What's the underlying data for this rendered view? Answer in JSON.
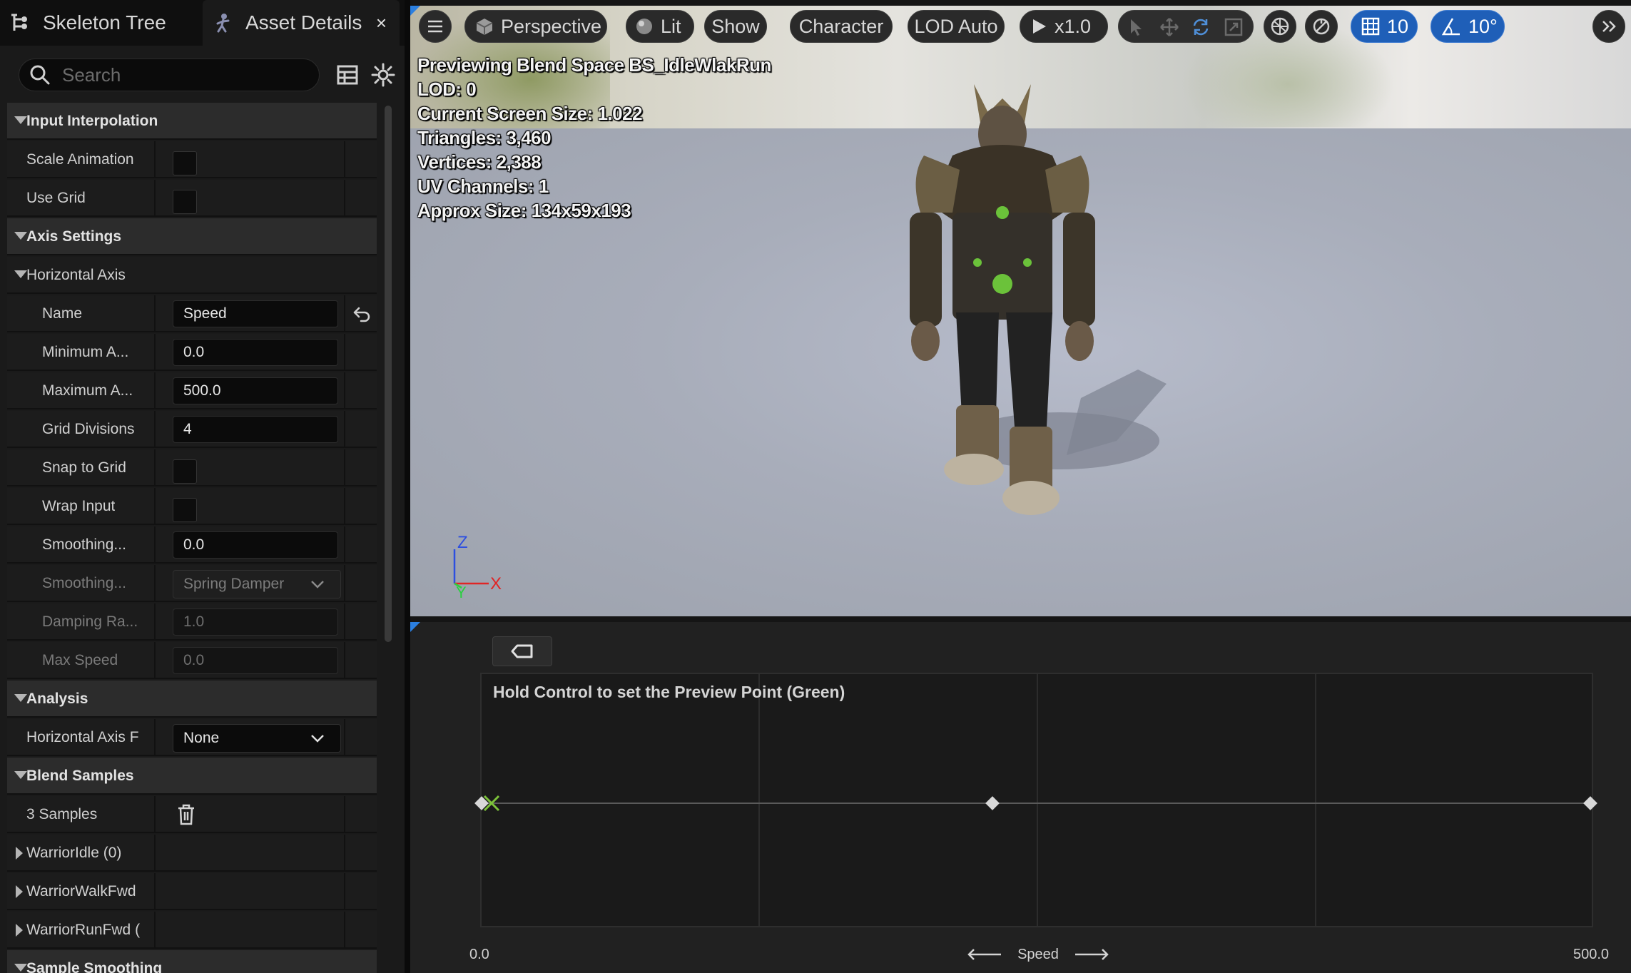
{
  "tabs": {
    "skeleton_tree": "Skeleton Tree",
    "asset_details": "Asset Details",
    "close": "×"
  },
  "search": {
    "placeholder": "Search"
  },
  "details": {
    "input_interpolation": {
      "header": "Input Interpolation",
      "scale_animation": "Scale Animation",
      "use_grid": "Use Grid"
    },
    "axis_settings": {
      "header": "Axis Settings",
      "horizontal_axis": {
        "header": "Horizontal Axis",
        "name_label": "Name",
        "name_value": "Speed",
        "min_label": "Minimum A...",
        "min_value": "0.0",
        "max_label": "Maximum A...",
        "max_value": "500.0",
        "grid_div_label": "Grid Divisions",
        "grid_div_value": "4",
        "snap_label": "Snap to Grid",
        "wrap_label": "Wrap Input",
        "smoothing_time_label": "Smoothing...",
        "smoothing_time_value": "0.0",
        "smoothing_type_label": "Smoothing...",
        "smoothing_type_value": "Spring Damper",
        "damping_label": "Damping Ra...",
        "damping_value": "1.0",
        "max_speed_label": "Max Speed",
        "max_speed_value": "0.0"
      }
    },
    "analysis": {
      "header": "Analysis",
      "horizontal_axis_fn_label": "Horizontal Axis F",
      "horizontal_axis_fn_value": "None"
    },
    "blend_samples": {
      "header": "Blend Samples",
      "count_label": "3 Samples",
      "samples": [
        "WarriorIdle (0)",
        "WarriorWalkFwd",
        "WarriorRunFwd ("
      ]
    },
    "sample_smoothing": {
      "header": "Sample Smoothing"
    }
  },
  "viewport": {
    "toolbar": {
      "perspective": "Perspective",
      "lit": "Lit",
      "show": "Show",
      "character": "Character",
      "lod": "LOD Auto",
      "speed": "x1.0",
      "grid_snap": "10",
      "rotation_snap": "10°"
    },
    "stats": [
      "Previewing Blend Space BS_IdleWlakRun",
      "LOD: 0",
      "Current Screen Size: 1.022",
      "Triangles: 3,460",
      "Vertices: 2,388",
      "UV Channels: 1",
      "Approx Size: 134x59x193"
    ],
    "axes": {
      "z": "Z",
      "x": "X",
      "y": "Y"
    },
    "colors": {
      "sky": "#d6d4c7",
      "floor": "#a8adba",
      "accent": "#2b7fe0"
    }
  },
  "blendspace": {
    "hint": "Hold Control to set the Preview Point (Green)",
    "axis_min": "0.0",
    "axis_max": "500.0",
    "axis_name": "Speed",
    "sample_positions": [
      0,
      230,
      500
    ],
    "preview_point": 0
  }
}
